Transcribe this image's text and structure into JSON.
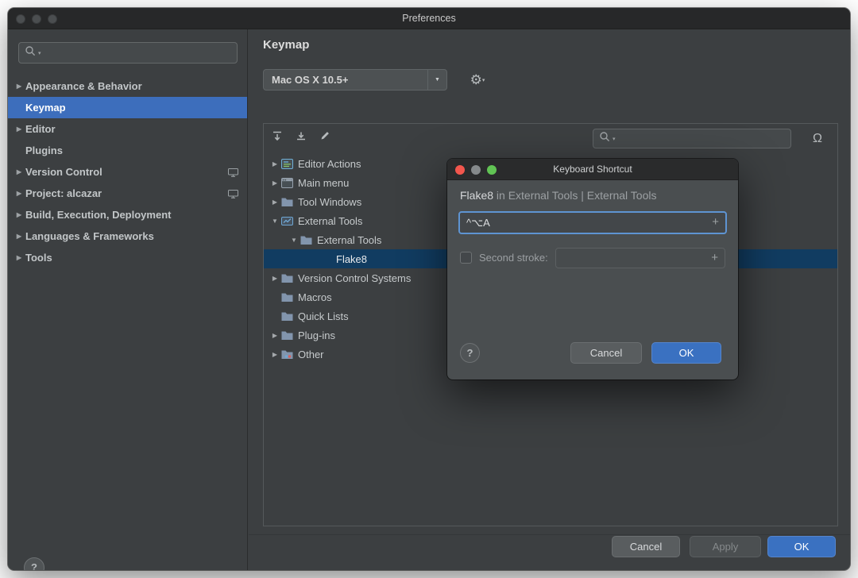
{
  "window": {
    "title": "Preferences"
  },
  "glyphs": {
    "arrow_right": "▶",
    "arrow_down": "▼",
    "combo_arrow": "▼",
    "search_caret": "▾",
    "gear": "⚙",
    "gear_caret": "▾",
    "omega": "Ω",
    "plus": "+",
    "help": "?"
  },
  "colors": {
    "accent_blue": "#3d6ebc",
    "tree_selection": "#113c61",
    "ok_blue": "#3a71c1",
    "focus_blue": "#5e94d2",
    "traffic_red": "#f2564d",
    "traffic_yellow": "#85898b",
    "traffic_green": "#61c454"
  },
  "sidebar": {
    "search_placeholder": "",
    "items": [
      {
        "label": "Appearance & Behavior",
        "arrow": true,
        "selected": false,
        "badge": false
      },
      {
        "label": "Keymap",
        "arrow": false,
        "selected": true,
        "badge": false
      },
      {
        "label": "Editor",
        "arrow": true,
        "selected": false,
        "badge": false
      },
      {
        "label": "Plugins",
        "arrow": false,
        "selected": false,
        "badge": false
      },
      {
        "label": "Version Control",
        "arrow": true,
        "selected": false,
        "badge": true
      },
      {
        "label": "Project: alcazar",
        "arrow": true,
        "selected": false,
        "badge": true
      },
      {
        "label": "Build, Execution, Deployment",
        "arrow": true,
        "selected": false,
        "badge": false
      },
      {
        "label": "Languages & Frameworks",
        "arrow": true,
        "selected": false,
        "badge": false
      },
      {
        "label": "Tools",
        "arrow": true,
        "selected": false,
        "badge": false
      }
    ]
  },
  "main": {
    "title": "Keymap",
    "keymap_scheme": "Mac OS X 10.5+",
    "tree": [
      {
        "label": "Editor Actions",
        "indent": 0,
        "arrow": "right",
        "icon": "editor-actions",
        "selected": false,
        "leaf": false
      },
      {
        "label": "Main menu",
        "indent": 0,
        "arrow": "right",
        "icon": "main-menu",
        "selected": false,
        "leaf": false
      },
      {
        "label": "Tool Windows",
        "indent": 0,
        "arrow": "right",
        "icon": "folder",
        "selected": false,
        "leaf": false
      },
      {
        "label": "External Tools",
        "indent": 0,
        "arrow": "down",
        "icon": "external-tools",
        "selected": false,
        "leaf": false
      },
      {
        "label": "External Tools",
        "indent": 1,
        "arrow": "down",
        "icon": "folder",
        "selected": false,
        "leaf": false
      },
      {
        "label": "Flake8",
        "indent": 2,
        "arrow": "none",
        "icon": "",
        "selected": true,
        "leaf": true
      },
      {
        "label": "Version Control Systems",
        "indent": 0,
        "arrow": "right",
        "icon": "folder",
        "selected": false,
        "leaf": false
      },
      {
        "label": "Macros",
        "indent": 0,
        "arrow": "none",
        "icon": "folder",
        "selected": false,
        "leaf": false
      },
      {
        "label": "Quick Lists",
        "indent": 0,
        "arrow": "none",
        "icon": "folder",
        "selected": false,
        "leaf": false
      },
      {
        "label": "Plug-ins",
        "indent": 0,
        "arrow": "right",
        "icon": "folder",
        "selected": false,
        "leaf": false
      },
      {
        "label": "Other",
        "indent": 0,
        "arrow": "right",
        "icon": "folder-other",
        "selected": false,
        "leaf": false
      }
    ]
  },
  "dialog": {
    "title": "Keyboard Shortcut",
    "subtitle": {
      "action": "Flake8",
      "context": " in External Tools | External Tools"
    },
    "first_stroke": {
      "value": "^⌥A"
    },
    "second_stroke_label": "Second stroke:",
    "buttons": {
      "cancel": "Cancel",
      "ok": "OK"
    }
  },
  "footer": {
    "buttons": {
      "cancel": "Cancel",
      "apply": "Apply",
      "ok": "OK"
    }
  }
}
